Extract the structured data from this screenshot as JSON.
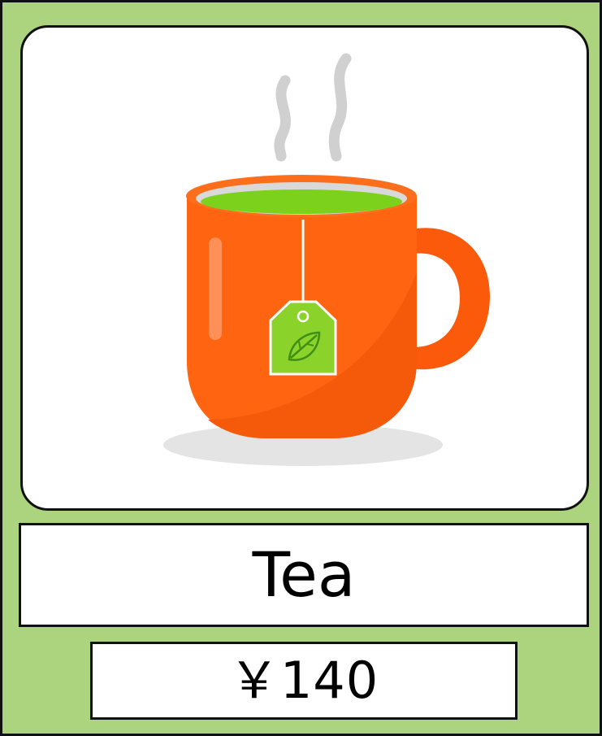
{
  "product": {
    "name": "Tea",
    "price": "￥140",
    "image_icon": "tea-mug-icon"
  },
  "colors": {
    "card_background": "#acd37d",
    "mug": "#ff6410",
    "tea": "#7cd11c",
    "tag": "#8bd22a"
  }
}
